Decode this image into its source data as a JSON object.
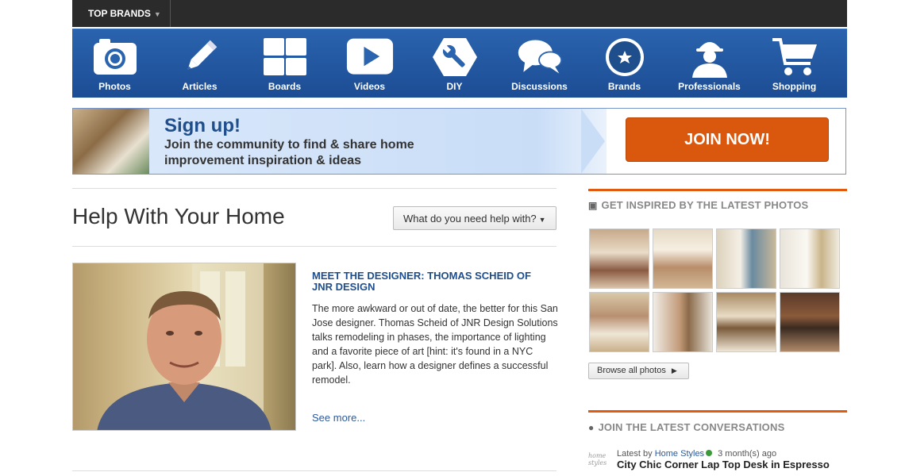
{
  "topbar": {
    "brands_label": "TOP BRANDS"
  },
  "nav": {
    "items": [
      {
        "label": "Photos",
        "icon": "camera-icon"
      },
      {
        "label": "Articles",
        "icon": "pencil-icon"
      },
      {
        "label": "Boards",
        "icon": "boards-grid-icon"
      },
      {
        "label": "Videos",
        "icon": "play-icon"
      },
      {
        "label": "DIY",
        "icon": "wrench-icon"
      },
      {
        "label": "Discussions",
        "icon": "speech-bubbles-icon"
      },
      {
        "label": "Brands",
        "icon": "star-badge-icon"
      },
      {
        "label": "Professionals",
        "icon": "hard-hat-worker-icon"
      },
      {
        "label": "Shopping",
        "icon": "shopping-cart-icon"
      }
    ]
  },
  "banner": {
    "title": "Sign up!",
    "subtitle": "Join the community to find & share home improvement inspiration & ideas",
    "cta": "JOIN NOW!"
  },
  "main": {
    "title": "Help With Your Home",
    "help_select": "What do you need help with?",
    "article": {
      "title": "MEET THE DESIGNER: THOMAS SCHEID OF JNR DESIGN",
      "body": "The more awkward or out of date, the better for this San Jose designer. Thomas Scheid of JNR Design Solutions talks remodeling in phases, the importance of lighting and a favorite piece of art [hint: it's found in a NYC park]. Also, learn how a designer defines a successful remodel.",
      "see_more": "See more..."
    }
  },
  "sidebar": {
    "photos_heading": "GET INSPIRED BY THE LATEST PHOTOS",
    "browse_label": "Browse all photos",
    "conversations_heading": "JOIN THE LATEST CONVERSATIONS",
    "conversation": {
      "latest_by": "Latest by",
      "user": "Home Styles",
      "time": "3 month(s) ago",
      "title": "City Chic Corner Lap Top Desk in Espresso",
      "logo_text": "home styles"
    }
  },
  "colors": {
    "nav_blue": "#2a63ae",
    "accent_orange": "#d9580e",
    "link_blue": "#1e4e8c",
    "topbar": "#2b2b2b"
  }
}
